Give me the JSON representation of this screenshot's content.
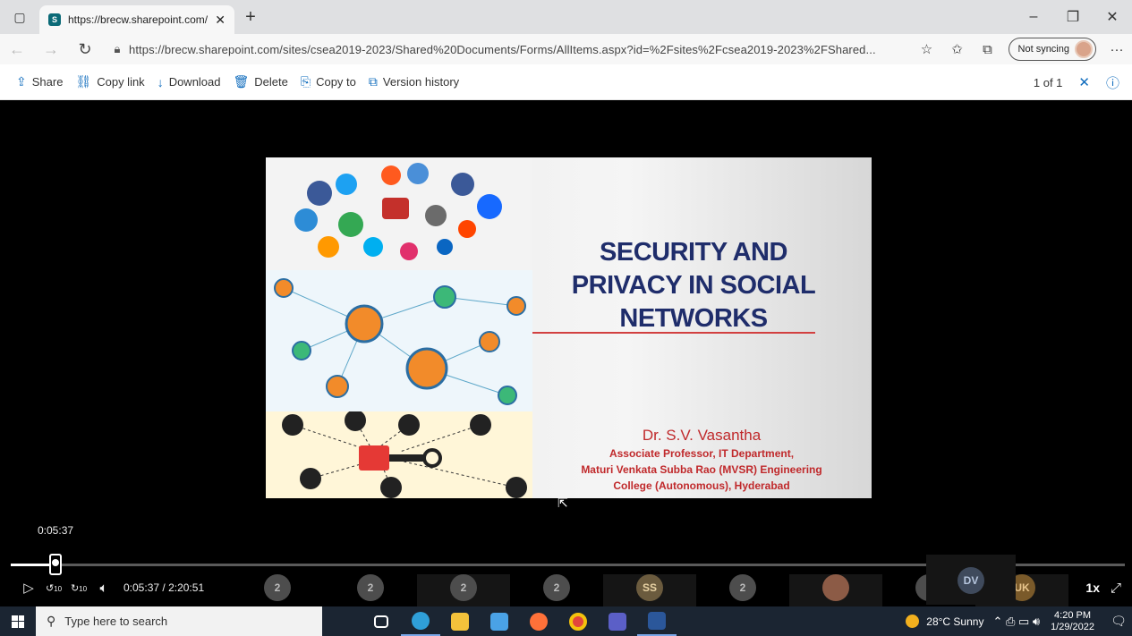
{
  "browser": {
    "tab_title": "https://brecw.sharepoint.com/sit",
    "url": "https://brecw.sharepoint.com/sites/csea2019-2023/Shared%20Documents/Forms/AllItems.aspx?id=%2Fsites%2Fcsea2019-2023%2FShared...",
    "sync_label": "Not syncing"
  },
  "commandbar": {
    "share": "Share",
    "copy_link": "Copy link",
    "download": "Download",
    "delete": "Delete",
    "copy_to": "Copy to",
    "version_history": "Version history",
    "page_count": "1 of 1"
  },
  "slide": {
    "title_line1": "SECURITY AND",
    "title_line2": "PRIVACY IN SOCIAL",
    "title_line3": "NETWORKS",
    "author_name": "Dr. S.V. Vasantha",
    "author_role": "Associate Professor,  IT Department,",
    "author_inst1": "Maturi Venkata Subba Rao (MVSR) Engineering",
    "author_inst2": "College (Autonomous), Hyderabad"
  },
  "player": {
    "hover_time": "0:05:37",
    "current_time": "0:05:37",
    "separator": "/",
    "duration": "2:20:51",
    "progress_fraction": 0.04,
    "speed": "1x",
    "skip_back": "10",
    "skip_forward": "10",
    "participants": [
      "2",
      "2",
      "2",
      "2",
      "SS",
      "2",
      "",
      "2",
      "UK",
      "DV"
    ]
  },
  "taskbar": {
    "search_placeholder": "Type here to search",
    "weather": "28°C  Sunny",
    "time": "4:20 PM",
    "date": "1/29/2022"
  },
  "colors": {
    "accent": "#0f6cbd",
    "slide_title": "#1f2d6b",
    "slide_author": "#c0292b",
    "taskbar_bg": "#1b2532"
  }
}
